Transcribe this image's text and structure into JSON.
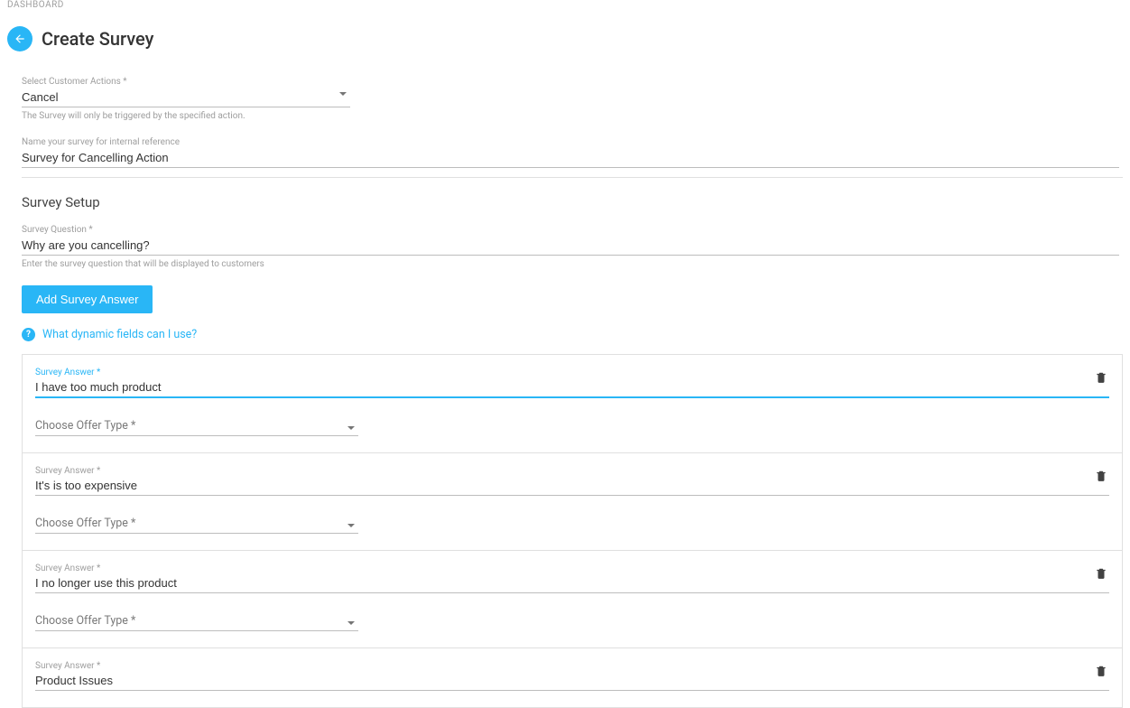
{
  "breadcrumb": "DASHBOARD",
  "header": {
    "title": "Create Survey"
  },
  "fields": {
    "customer_actions": {
      "label": "Select Customer Actions *",
      "value": "Cancel",
      "helper": "The Survey will only be triggered by the specified action."
    },
    "survey_name": {
      "label": "Name your survey for internal reference",
      "value": "Survey for Cancelling Action"
    }
  },
  "survey_setup": {
    "heading": "Survey Setup",
    "question": {
      "label": "Survey Question *",
      "value": "Why are you cancelling?",
      "helper": "Enter the survey question that will be displayed to customers"
    },
    "add_answer_btn": "Add Survey Answer",
    "help_link": "What dynamic fields can I use?"
  },
  "answer_section": {
    "answer_label": "Survey Answer *",
    "offer_label": "Choose Offer Type *"
  },
  "answers": [
    {
      "value": "I have too much product",
      "active": true,
      "show_offer": true
    },
    {
      "value": "It's is too expensive",
      "active": false,
      "show_offer": true
    },
    {
      "value": "I no longer use this product",
      "active": false,
      "show_offer": true
    },
    {
      "value": "Product Issues",
      "active": false,
      "show_offer": false
    }
  ]
}
